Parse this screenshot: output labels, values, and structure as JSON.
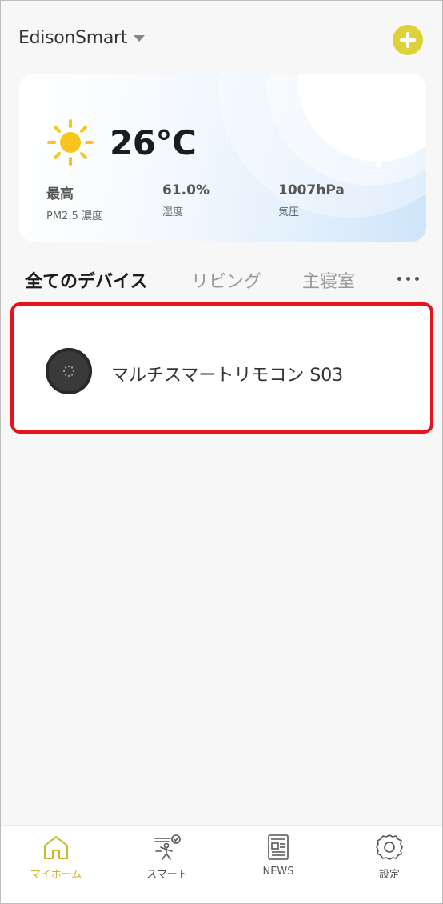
{
  "header": {
    "home_name": "EdisonSmart",
    "add_icon": "plus-circle-icon",
    "accent_color": "#dcd33a"
  },
  "weather": {
    "icon": "sun-icon",
    "temperature": "26°C",
    "stats": [
      {
        "value": "最高",
        "label": "PM2.5 濃度"
      },
      {
        "value": "61.0%",
        "label": "湿度"
      },
      {
        "value": "1007hPa",
        "label": "気圧"
      }
    ]
  },
  "tabs": {
    "items": [
      "全てのデバイス",
      "リビング",
      "主寝室"
    ],
    "active_index": 0,
    "more_icon": "more-dots-icon"
  },
  "devices": [
    {
      "name": "マルチスマートリモコン S03",
      "icon": "remote-hub-icon",
      "highlighted": true,
      "highlight_color": "#e3141b"
    }
  ],
  "bottom_nav": {
    "items": [
      {
        "label": "マイホーム",
        "icon": "home-icon",
        "active": true
      },
      {
        "label": "スマート",
        "icon": "smart-scene-icon",
        "active": false
      },
      {
        "label": "NEWS",
        "icon": "news-icon",
        "active": false
      },
      {
        "label": "設定",
        "icon": "gear-icon",
        "active": false
      }
    ],
    "active_color": "#c9b82a"
  }
}
